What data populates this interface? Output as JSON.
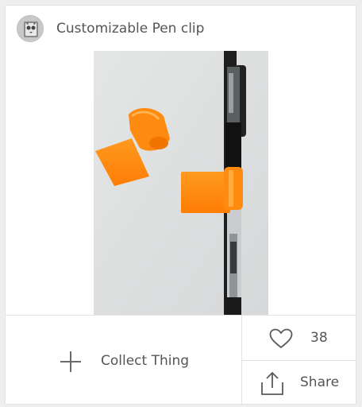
{
  "thing": {
    "title": "Customizable Pen clip"
  },
  "actions": {
    "collect_label": "Collect Thing",
    "like_count": "38",
    "share_label": "Share"
  },
  "icons": {
    "avatar": "user-avatar",
    "collect": "plus-icon",
    "like": "heart-icon",
    "share": "share-icon"
  },
  "colors": {
    "clip_orange": "#ff8a10",
    "pen_body": "#1c1c1c",
    "text": "#555555",
    "border": "#e2e2e2"
  }
}
